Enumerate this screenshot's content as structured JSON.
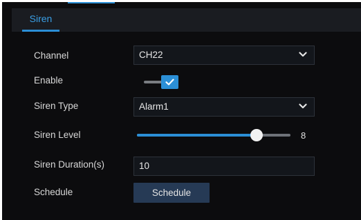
{
  "tabs": [
    {
      "label": "Siren",
      "active": true
    }
  ],
  "form": {
    "channel": {
      "label": "Channel",
      "value": "CH22"
    },
    "enable": {
      "label": "Enable",
      "checked": true
    },
    "siren_type": {
      "label": "Siren Type",
      "value": "Alarm1"
    },
    "siren_level": {
      "label": "Siren Level",
      "value": "8",
      "fraction": 0.78
    },
    "siren_duration": {
      "label": "Siren Duration(s)",
      "value": "10"
    },
    "schedule": {
      "label": "Schedule",
      "button_label": "Schedule"
    }
  },
  "colors": {
    "accent": "#2b8fd6",
    "background": "#0c0c0e",
    "button": "#263a55"
  },
  "icons": {
    "dropdown": "chevron-down-icon",
    "check": "check-icon"
  }
}
